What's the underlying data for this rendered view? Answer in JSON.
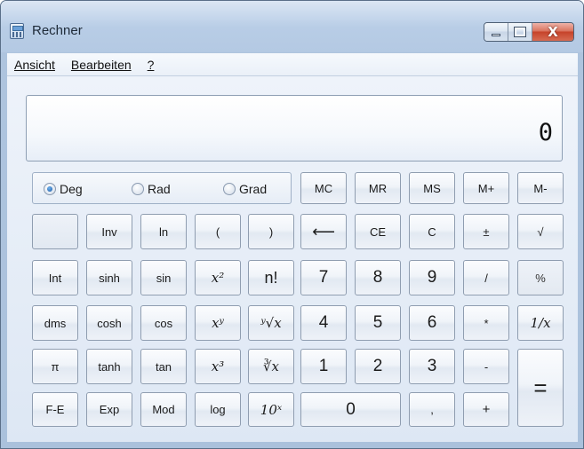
{
  "window": {
    "title": "Rechner"
  },
  "menu": {
    "items": [
      "Ansicht",
      "Bearbeiten",
      "?"
    ]
  },
  "display": {
    "value": "0"
  },
  "angle_units": {
    "options": [
      "Deg",
      "Rad",
      "Grad"
    ],
    "selected": "Deg"
  },
  "memory": [
    "MC",
    "MR",
    "MS",
    "M+",
    "M-"
  ],
  "keys": {
    "inv": "Inv",
    "ln": "ln",
    "lparen": "(",
    "rparen": ")",
    "back": "⟵",
    "ce": "CE",
    "c": "C",
    "sign": "±",
    "sqrt": "√",
    "int": "Int",
    "sinh": "sinh",
    "sin": "sin",
    "x2": "x²",
    "fact": "n!",
    "n7": "7",
    "n8": "8",
    "n9": "9",
    "div": "/",
    "pct": "%",
    "dms": "dms",
    "cosh": "cosh",
    "cos": "cos",
    "xy": "xʸ",
    "yroot": "ʸ√x",
    "n4": "4",
    "n5": "5",
    "n6": "6",
    "mul": "*",
    "recip": "1/x",
    "pi": "π",
    "tanh": "tanh",
    "tan": "tan",
    "x3": "x³",
    "croot": "∛x",
    "n1": "1",
    "n2": "2",
    "n3": "3",
    "sub": "-",
    "eq": "=",
    "fe": "F-E",
    "exp": "Exp",
    "mod": "Mod",
    "log": "log",
    "tenx": "10ˣ",
    "n0": "0",
    "dec": ",",
    "add": "+"
  }
}
